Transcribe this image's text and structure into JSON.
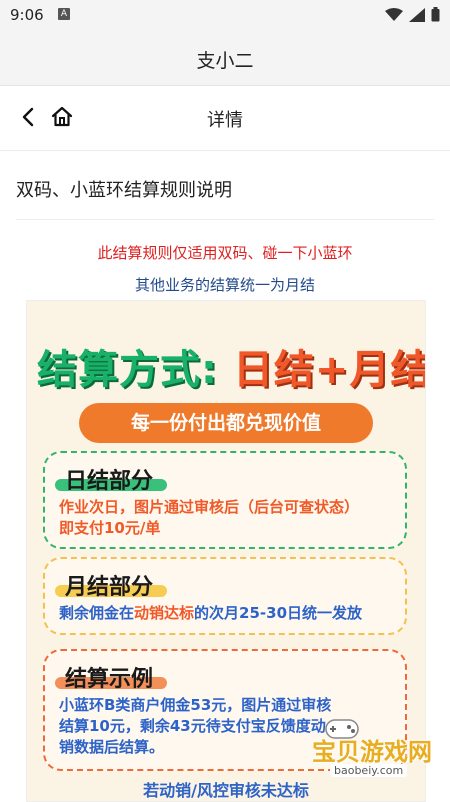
{
  "status_bar": {
    "time": "9:06",
    "notification_badge": "A"
  },
  "app": {
    "title": "支小二"
  },
  "nav": {
    "title": "详情",
    "back_icon": "chevron-left-icon",
    "home_icon": "home-icon"
  },
  "article": {
    "title": "双码、小蓝环结算规则说明",
    "notice_red": "此结算规则仅适用双码、碰一下小蓝环",
    "notice_blue": "其他业务的结算统一为月结"
  },
  "poster": {
    "headline_part1": "结算方式:",
    "headline_part2": "日结+月结",
    "slogan": "每一份付出都兑现价值",
    "daily": {
      "heading": "日结部分",
      "line1": "作业次日，图片通过审核后（后台可查状态）",
      "line2": "即支付10元/单"
    },
    "monthly": {
      "heading": "月结部分",
      "text_a": "剩余佣金在",
      "text_b": "动销达标",
      "text_c": "的次月",
      "text_d": "25-30日统一发放"
    },
    "example": {
      "heading": "结算示例",
      "line1": "小蓝环B类商户佣金53元，图片通过审核",
      "line2": "结算10元，剩余43元待支付宝反馈度动",
      "line3": "销数据后结算。"
    },
    "bottom_caption": "若动销/风控审核未达标"
  },
  "watermark": {
    "text": "宝贝游戏网",
    "url": "baobeiy.com"
  },
  "colors": {
    "red": "#e02020",
    "blue": "#234a8a",
    "green": "#19b06a",
    "orange": "#f0582a"
  }
}
